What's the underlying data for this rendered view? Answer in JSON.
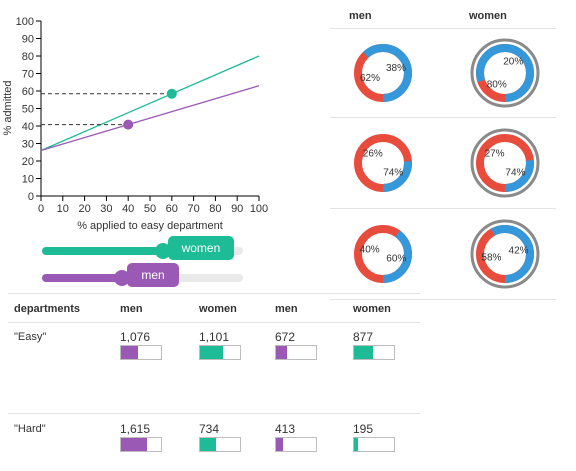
{
  "colors": {
    "women": "#1ebc96",
    "men": "#9b59b6",
    "admitted": "#3498db",
    "rejected": "#e74c3c",
    "women_ring": "#8a8a8a"
  },
  "chart_data": {
    "type": "line",
    "xlabel": "% applied to easy department",
    "ylabel": "% admitted",
    "xlim": [
      0,
      100
    ],
    "ylim": [
      0,
      100
    ],
    "x_ticks": [
      "0",
      "10",
      "20",
      "30",
      "40",
      "50",
      "60",
      "70",
      "80",
      "90",
      "100"
    ],
    "y_ticks": [
      "0",
      "10",
      "20",
      "30",
      "40",
      "50",
      "60",
      "70",
      "80",
      "90",
      "100"
    ],
    "series": [
      {
        "name": "women",
        "x": [
          0,
          100
        ],
        "y": [
          26,
          80
        ],
        "marker": {
          "x": 60,
          "y": 58.4
        }
      },
      {
        "name": "men",
        "x": [
          0,
          100
        ],
        "y": [
          26,
          63
        ],
        "marker": {
          "x": 40,
          "y": 40.8
        }
      }
    ]
  },
  "sliders": [
    {
      "label": "women",
      "value": 60
    },
    {
      "label": "men",
      "value": 40
    }
  ],
  "donut_grid": {
    "headers": [
      "men",
      "women"
    ],
    "rows": [
      {
        "men": {
          "admitted": 62,
          "rejected": 38,
          "admitted_label": "62%",
          "rejected_label": "38%"
        },
        "women": {
          "admitted": 80,
          "rejected": 20,
          "admitted_label": "80%",
          "rejected_label": "20%"
        }
      },
      {
        "men": {
          "admitted": 26,
          "rejected": 74,
          "admitted_label": "26%",
          "rejected_label": "74%"
        },
        "women": {
          "admitted": 27,
          "rejected": 74,
          "admitted_label": "27%",
          "rejected_label": "74%"
        }
      },
      {
        "men": {
          "admitted": 40,
          "rejected": 60,
          "admitted_label": "40%",
          "rejected_label": "60%"
        },
        "women": {
          "admitted": 58,
          "rejected": 42,
          "admitted_label": "58%",
          "rejected_label": "42%"
        }
      }
    ]
  },
  "table": {
    "headers": [
      "departments",
      "men",
      "women",
      "men",
      "women"
    ],
    "rows": [
      {
        "label": "\"Easy\"",
        "cells": [
          {
            "text": "1,076",
            "fill": 0.42,
            "group": "men"
          },
          {
            "text": "1,101",
            "fill": 0.58,
            "group": "women"
          },
          {
            "text": "672",
            "fill": 0.28,
            "group": "men"
          },
          {
            "text": "877",
            "fill": 0.48,
            "group": "women"
          }
        ]
      },
      {
        "label": "\"Hard\"",
        "cells": [
          {
            "text": "1,615",
            "fill": 0.64,
            "group": "men"
          },
          {
            "text": "734",
            "fill": 0.4,
            "group": "women"
          },
          {
            "text": "413",
            "fill": 0.17,
            "group": "men"
          },
          {
            "text": "195",
            "fill": 0.1,
            "group": "women"
          }
        ]
      }
    ]
  }
}
